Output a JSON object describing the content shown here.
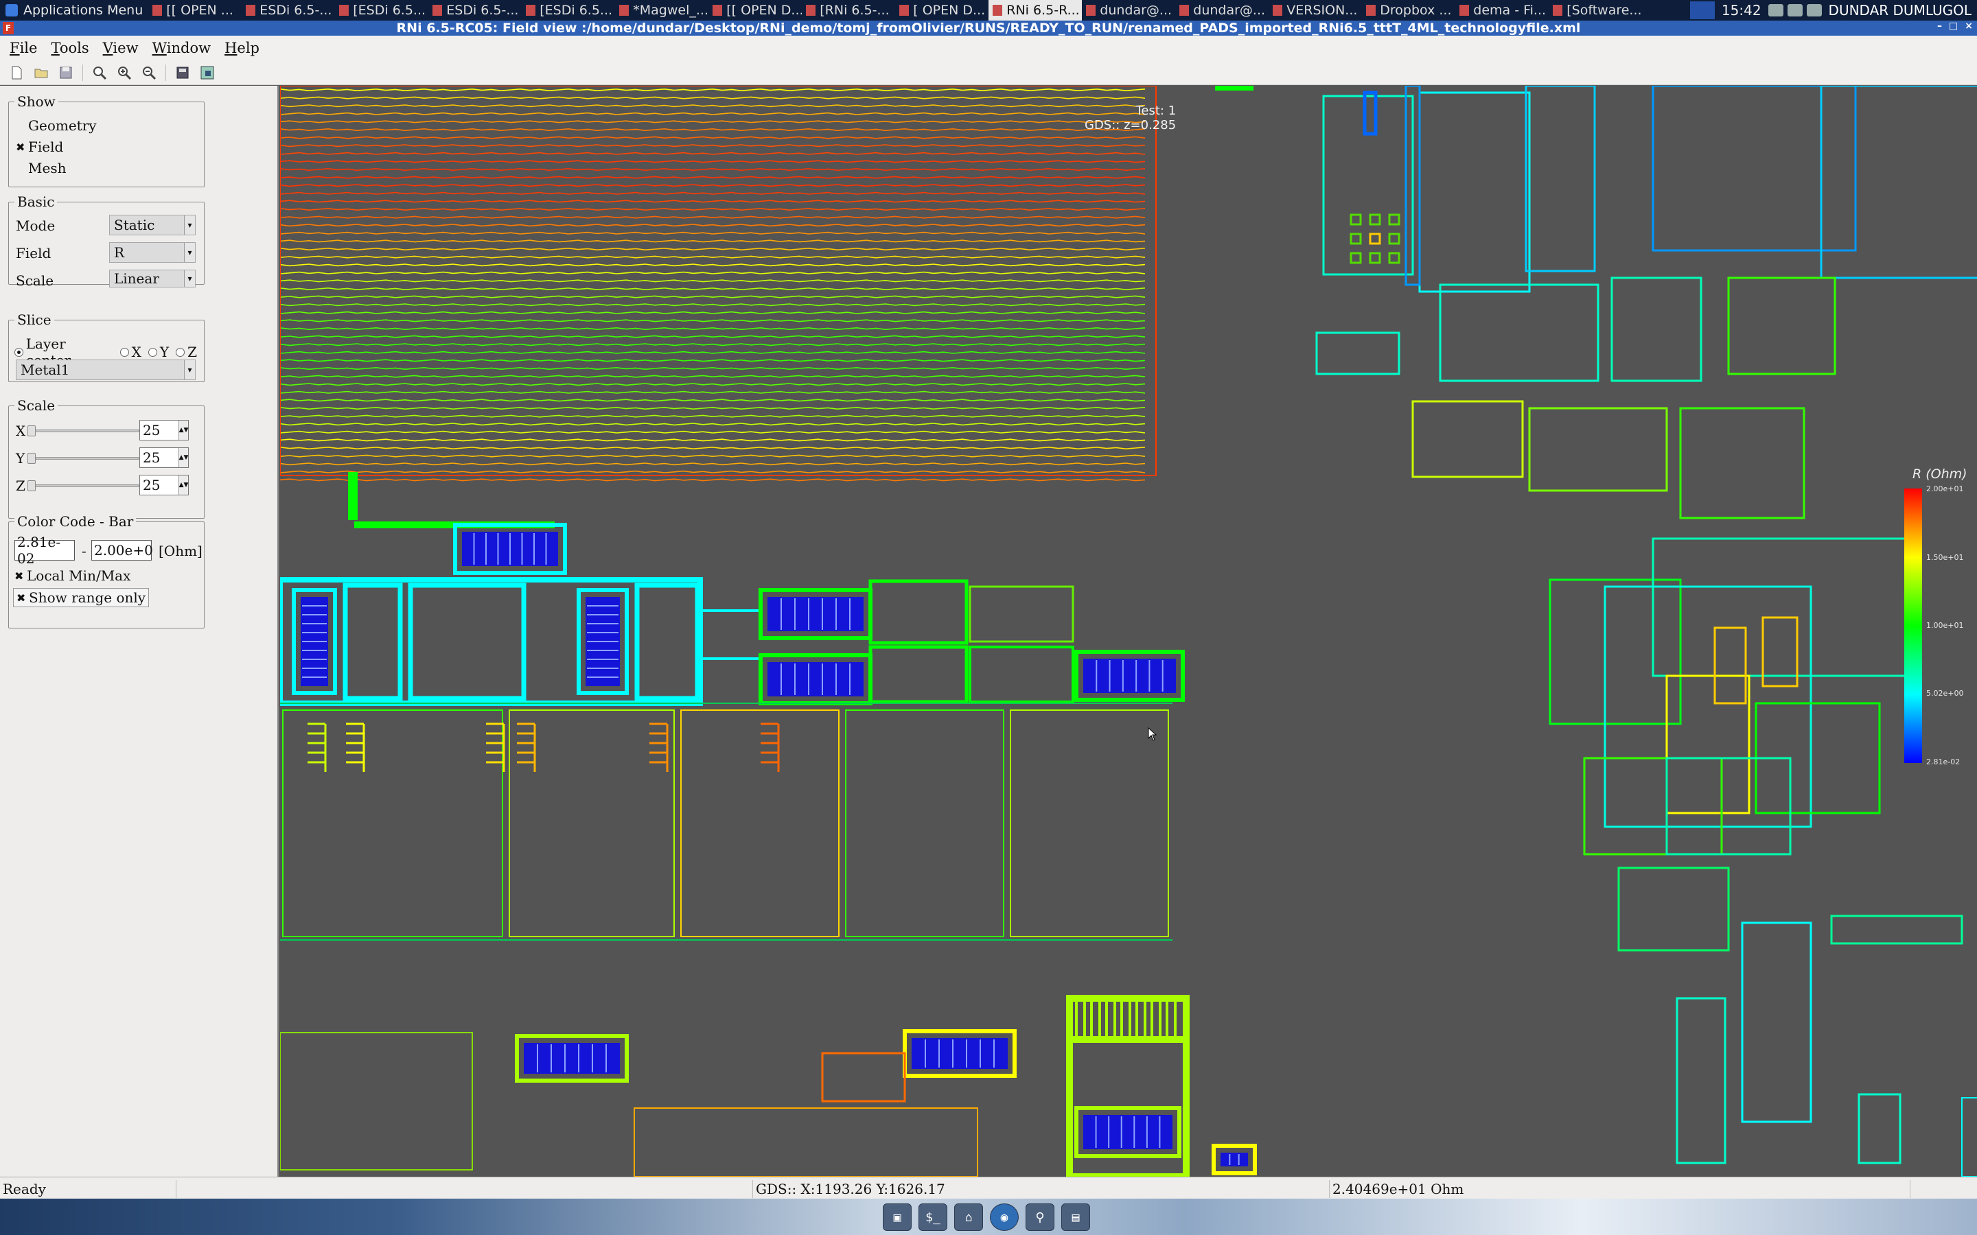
{
  "system_panel": {
    "apps_menu": "Applications Menu",
    "tasks": [
      "[[ OPEN ...",
      "ESDi 6.5-...",
      "[ESDi 6.5...",
      "ESDi 6.5-...",
      "[ESDi 6.5...",
      "*Magwel_...",
      "[[ OPEN D...",
      "[RNi 6.5-...",
      "[ OPEN D...",
      "RNi 6.5-R...",
      "dundar@...",
      "dundar@...",
      "VERSION...",
      "Dropbox ...",
      "dema - Fi...",
      "[Software..."
    ],
    "active_task_index": 9,
    "clock": "15:42",
    "user": "DUNDAR DUMLUGOL"
  },
  "window": {
    "title": "RNi 6.5-RC05: Field view :/home/dundar/Desktop/RNi_demo/tomj_fromOlivier/RUNS/READY_TO_RUN/renamed_PADS_imported_RNi6.5_tttT_4ML_technologyfile.xml"
  },
  "menubar": {
    "items": [
      "File",
      "Tools",
      "View",
      "Window",
      "Help"
    ]
  },
  "toolbar": {
    "buttons": [
      "new-file-icon",
      "open-folder-icon",
      "save-icon",
      "zoom-fit-icon",
      "zoom-in-icon",
      "zoom-out-icon",
      "export-icon",
      "screenshot-icon"
    ]
  },
  "panel": {
    "show": {
      "title": "Show",
      "options": [
        {
          "label": "Geometry",
          "checked": false
        },
        {
          "label": "Field",
          "checked": true
        },
        {
          "label": "Mesh",
          "checked": false
        }
      ]
    },
    "basic": {
      "title": "Basic",
      "mode_label": "Mode",
      "mode_value": "Static",
      "field_label": "Field",
      "field_value": "R",
      "scale_label": "Scale",
      "scale_value": "Linear"
    },
    "slice": {
      "title": "Slice",
      "radios": [
        "Layer center",
        "X",
        "Y",
        "Z"
      ],
      "selected": "Layer center",
      "layer_value": "Metal1"
    },
    "scale": {
      "title": "Scale",
      "x_label": "X",
      "x_value": "25",
      "y_label": "Y",
      "y_value": "25",
      "z_label": "Z",
      "z_value": "25"
    },
    "color_code": {
      "title": "Color Code - Bar",
      "min_value": "2.81e-02",
      "separator": "-",
      "max_value": "2.00e+0",
      "unit": "[Ohm]",
      "local_minmax_label": "Local Min/Max",
      "local_minmax_checked": true,
      "show_range_label": "Show range only",
      "show_range_checked": true
    }
  },
  "viewport": {
    "test_label": "Test: 1",
    "gds_label": "GDS:: z=0.285",
    "legend": {
      "title": "R (Ohm)",
      "ticks": [
        "2.00e+01",
        "1.50e+01",
        "1.00e+01",
        "5.02e+00",
        "2.81e-02"
      ],
      "colors": [
        "#ff0000",
        "#ffff00",
        "#00ff00",
        "#00ffff",
        "#0000ff"
      ]
    }
  },
  "statusbar": {
    "state": "Ready",
    "coords": "GDS:: X:1193.26 Y:1626.17",
    "value": "2.40469e+01 Ohm"
  },
  "dock": {
    "icons": [
      "monitor-icon",
      "terminal-icon",
      "home-folder-icon",
      "web-browser-icon",
      "search-icon",
      "files-icon"
    ]
  }
}
